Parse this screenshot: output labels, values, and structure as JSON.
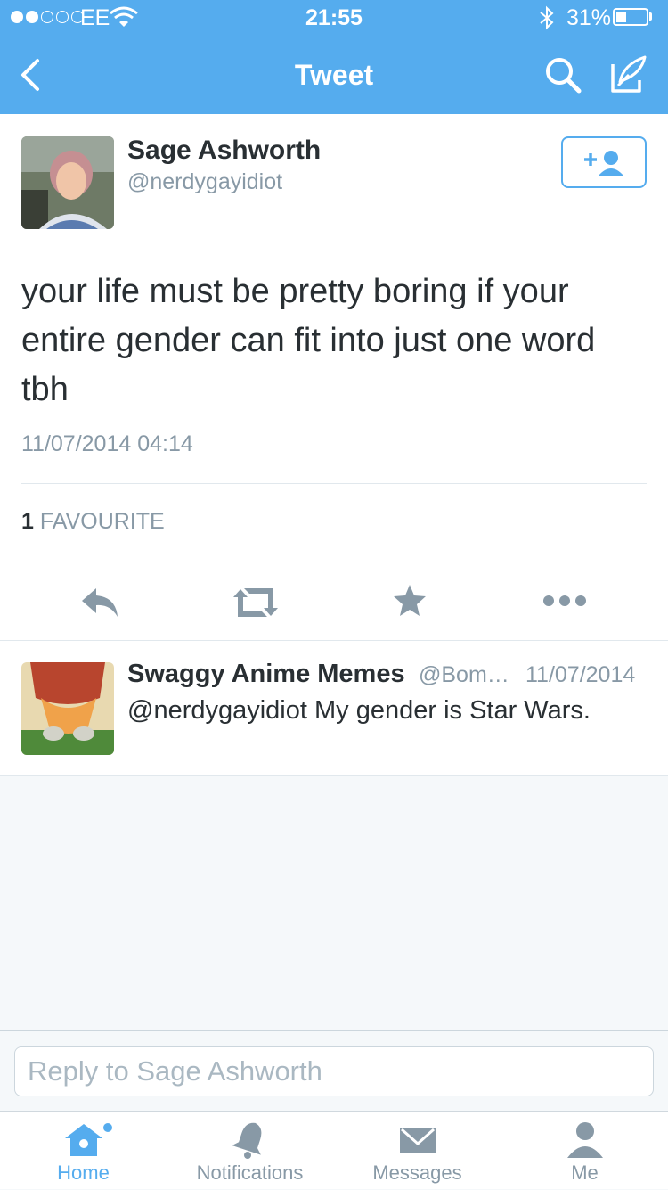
{
  "status_bar": {
    "carrier": "EE",
    "time": "21:55",
    "battery": "31%",
    "battery_level": 0.31
  },
  "nav": {
    "title": "Tweet"
  },
  "tweet": {
    "author_name": "Sage Ashworth",
    "author_handle": "@nerdygayidiot",
    "text": "your life must be pretty boring if your entire gender can fit into just one word tbh",
    "timestamp": "11/07/2014 04:14",
    "favourite_count": "1",
    "favourite_label": "FAVOURITE"
  },
  "reply": {
    "author_name": "Swaggy Anime Memes",
    "author_handle": "@Bom…",
    "timestamp": "11/07/2014",
    "text": "@nerdygayidiot My gender is Star Wars."
  },
  "reply_box": {
    "placeholder": "Reply to Sage Ashworth"
  },
  "tabs": [
    {
      "label": "Home",
      "icon": "home-icon",
      "active": true
    },
    {
      "label": "Notifications",
      "icon": "bell-icon",
      "active": false
    },
    {
      "label": "Messages",
      "icon": "envelope-icon",
      "active": false
    },
    {
      "label": "Me",
      "icon": "person-icon",
      "active": false
    }
  ],
  "colors": {
    "accent": "#55acee",
    "muted": "#8899a6",
    "text": "#292f33",
    "icon_grey": "#8899a6"
  }
}
